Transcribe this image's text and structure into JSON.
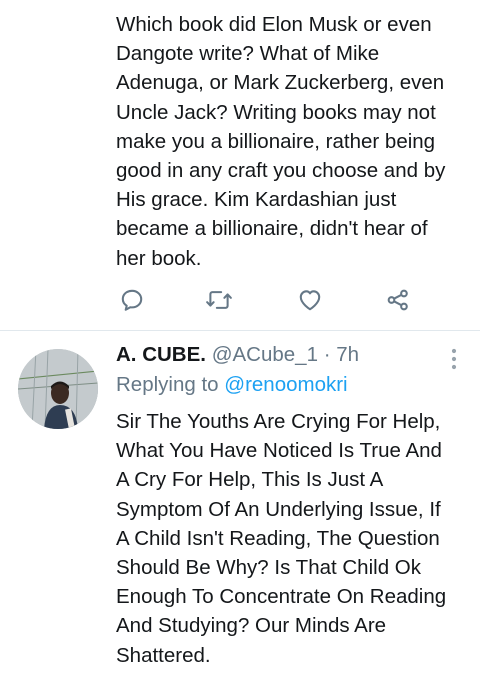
{
  "tweet1": {
    "lines": [
      "Which book did Elon Musk or even",
      "Dangote write? What of Mike",
      "Adenuga, or Mark Zuckerberg, even",
      "Uncle Jack? Writing books may not",
      "make you a billionaire, rather being",
      "good in any craft you choose and by",
      "His grace. Kim Kardashian just",
      "became  a billionaire, didn't hear of",
      "her book."
    ],
    "actions": [
      "reply-icon",
      "retweet-icon",
      "like-icon",
      "share-icon"
    ]
  },
  "tweet2": {
    "name": "A. CUBE.",
    "handle": "@ACube_1",
    "separator": "·",
    "time": "7h",
    "replying_prefix": "Replying to",
    "replying_to": "@renoomokri",
    "lines": [
      "Sir The Youths Are Crying For Help,",
      "What You Have Noticed Is True And",
      "A Cry For Help, This Is Just A",
      "Symptom Of An Underlying Issue, If",
      "A Child Isn't Reading, The Question",
      "Should Be Why? Is That Child Ok",
      "Enough To Concentrate On Reading",
      "And Studying? Our Minds Are",
      "Shattered."
    ]
  },
  "colors": {
    "text": "#14171a",
    "secondary": "#657786",
    "accent": "#1da1f2",
    "divider": "#e1e8ed"
  }
}
